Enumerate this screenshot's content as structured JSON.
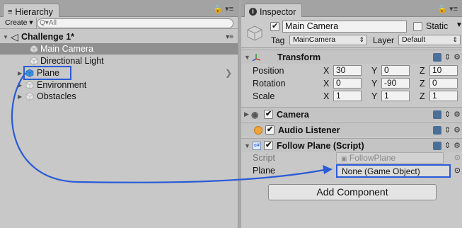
{
  "hierarchy": {
    "tab_label": "Hierarchy",
    "tab_icon": "list-icon",
    "create_label": "Create",
    "search_placeholder": "All",
    "scene_name": "Challenge 1*",
    "items": [
      {
        "label": "Main Camera",
        "selected": true
      },
      {
        "label": "Directional Light"
      },
      {
        "label": "Plane",
        "highlighted": true
      },
      {
        "label": "Environment"
      },
      {
        "label": "Obstacles"
      }
    ]
  },
  "inspector": {
    "tab_label": "Inspector",
    "tab_icon": "info-icon",
    "object_name": "Main Camera",
    "static_label": "Static",
    "tag_label": "Tag",
    "tag_value": "MainCamera",
    "layer_label": "Layer",
    "layer_value": "Default",
    "transform": {
      "title": "Transform",
      "rows": [
        {
          "label": "Position",
          "x": "30",
          "y": "0",
          "z": "10"
        },
        {
          "label": "Rotation",
          "x": "0",
          "y": "-90",
          "z": "0"
        },
        {
          "label": "Scale",
          "x": "1",
          "y": "1",
          "z": "1"
        }
      ],
      "axis_labels": {
        "x": "X",
        "y": "Y",
        "z": "Z"
      }
    },
    "camera_title": "Camera",
    "audio_listener_title": "Audio Listener",
    "follow_plane": {
      "title": "Follow Plane (Script)",
      "script_label": "Script",
      "script_value": "FollowPlane",
      "plane_label": "Plane",
      "plane_value": "None (Game Object)"
    },
    "add_component_label": "Add Component"
  },
  "colors": {
    "selection": "#8e8e8e",
    "highlight_box": "#2a5bd7",
    "drag_arrow": "#2a5bd7",
    "plane_icon": "#3a8fe0"
  }
}
